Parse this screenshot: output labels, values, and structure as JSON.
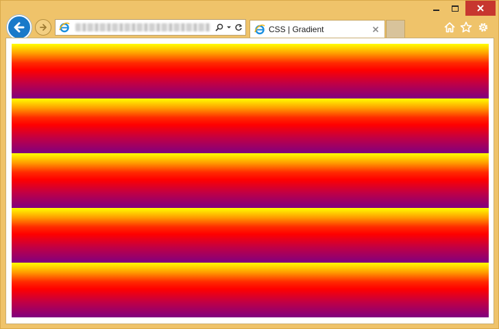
{
  "window": {
    "controls": {
      "minimize": "minimize",
      "maximize": "maximize",
      "close": "close"
    }
  },
  "nav": {
    "back_icon": "back-arrow-icon",
    "forward_icon": "forward-arrow-icon",
    "address": {
      "favicon": "ie-icon",
      "search_icon": "search-icon",
      "dropdown_icon": "chevron-down-icon",
      "refresh_icon": "refresh-icon"
    }
  },
  "tab": {
    "favicon": "ie-icon",
    "title": "CSS | Gradient",
    "close_icon": "close-icon"
  },
  "toolbar_right": {
    "home_icon": "home-icon",
    "favorites_icon": "star-icon",
    "tools_icon": "gear-icon"
  },
  "colors": {
    "frame": "#f0c468",
    "gradient_stops": [
      "#ffff00",
      "#ff0000",
      "#800080"
    ]
  },
  "content": {
    "band_count": 5,
    "bands": [
      {
        "id": 1
      },
      {
        "id": 2
      },
      {
        "id": 3
      },
      {
        "id": 4
      },
      {
        "id": 5
      }
    ]
  }
}
